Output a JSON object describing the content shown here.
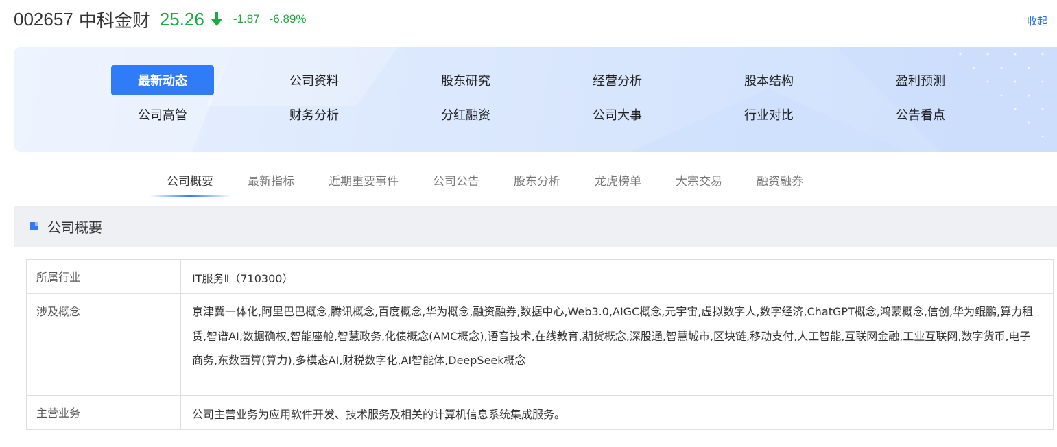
{
  "header": {
    "code": "002657",
    "name": "中科金财",
    "price": "25.26",
    "change": "-1.87",
    "change_pct": "-6.89%",
    "collapse_label": "收起",
    "down_color": "#1aab41"
  },
  "nav": {
    "items": [
      {
        "label": "最新动态",
        "active": true
      },
      {
        "label": "公司资料"
      },
      {
        "label": "股东研究"
      },
      {
        "label": "经营分析"
      },
      {
        "label": "股本结构"
      },
      {
        "label": "盈利预测"
      },
      {
        "label": "公司高管"
      },
      {
        "label": "财务分析"
      },
      {
        "label": "分红融资"
      },
      {
        "label": "公司大事"
      },
      {
        "label": "行业对比"
      },
      {
        "label": "公告看点"
      }
    ],
    "accent": "#2f7cf6"
  },
  "sub_tabs": [
    {
      "label": "公司概要",
      "active": true
    },
    {
      "label": "最新指标"
    },
    {
      "label": "近期重要事件"
    },
    {
      "label": "公司公告"
    },
    {
      "label": "股东分析"
    },
    {
      "label": "龙虎榜单"
    },
    {
      "label": "大宗交易"
    },
    {
      "label": "融资融券"
    }
  ],
  "section": {
    "title": "公司概要"
  },
  "table": {
    "rows": [
      {
        "label": "所属行业",
        "value": "IT服务Ⅱ（710300）"
      },
      {
        "label": "涉及概念",
        "value": "京津冀一体化,阿里巴巴概念,腾讯概念,百度概念,华为概念,融资融券,数据中心,Web3.0,AIGC概念,元宇宙,虚拟数字人,数字经济,ChatGPT概念,鸿蒙概念,信创,华为鲲鹏,算力租赁,智谱AI,数据确权,智能座舱,智慧政务,化债概念(AMC概念),语音技术,在线教育,期货概念,深股通,智慧城市,区块链,移动支付,人工智能,互联网金融,工业互联网,数字货币,电子商务,东数西算(算力),多模态AI,财税数字化,AI智能体,DeepSeek概念"
      },
      {
        "label": "主营业务",
        "value": "公司主营业务为应用软件开发、技术服务及相关的计算机信息系统集成服务。"
      }
    ]
  }
}
